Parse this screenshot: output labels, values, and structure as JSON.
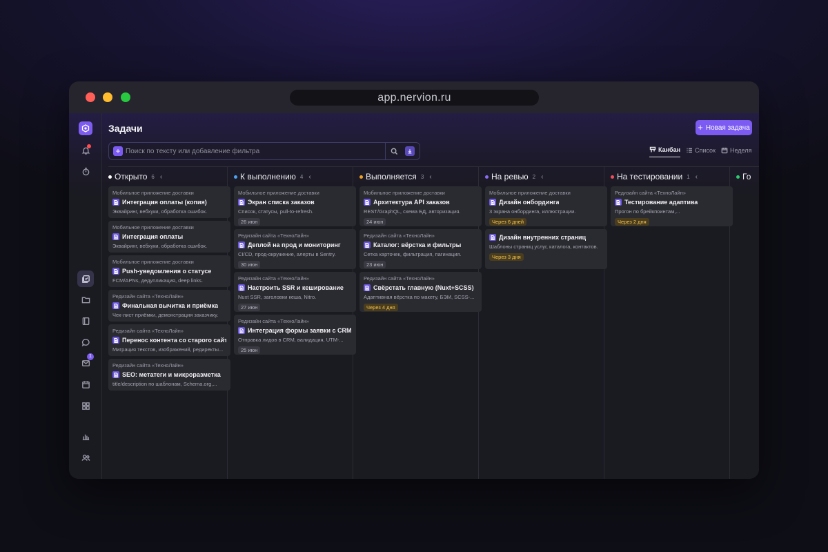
{
  "window": {
    "url": "app.nervion.ru"
  },
  "header": {
    "title": "Задачи",
    "new_task_label": "Новая задача"
  },
  "search": {
    "placeholder": "Поиск по тексту или добавление фильтра"
  },
  "views": [
    {
      "label": "Канбан",
      "active": true,
      "icon": "kanban-icon"
    },
    {
      "label": "Список",
      "active": false,
      "icon": "list-icon"
    },
    {
      "label": "Неделя",
      "active": false,
      "icon": "calendar-icon"
    }
  ],
  "sidebar": {
    "mail_badge": "1"
  },
  "columns": [
    {
      "title": "Открыто",
      "count": "6",
      "color": "#ffffff",
      "cards": [
        {
          "project": "Мобильное приложение доставки",
          "title": "Интеграция оплаты (копия)",
          "desc": "Эквайринг, вебхуки, обработка ошибок."
        },
        {
          "project": "Мобильное приложение доставки",
          "title": "Интеграция оплаты",
          "desc": "Эквайринг, вебхуки, обработка ошибок."
        },
        {
          "project": "Мобильное приложение доставки",
          "title": "Push-уведомления о статусе",
          "desc": "FCM/APNs, дедупликация, deep links."
        },
        {
          "project": "Редизайн сайта «ТехноЛайн»",
          "title": "Финальная вычитка и приёмка",
          "desc": "Чек-лист приёмки, демонстрация заказчику."
        },
        {
          "project": "Редизайн сайта «ТехноЛайн»",
          "title": "Перенос контента со старого сайта",
          "desc": "Миграция текстов, изображений, редиректы..."
        },
        {
          "project": "Редизайн сайта «ТехноЛайн»",
          "title": "SEO: метатеги и микроразметка",
          "desc": "title/description по шаблонам, Schema.org,..."
        }
      ]
    },
    {
      "title": "К выполнению",
      "count": "4",
      "color": "#4ea1f3",
      "cards": [
        {
          "project": "Мобильное приложение доставки",
          "title": "Экран списка заказов",
          "desc": "Список, статусы, pull-to-refresh.",
          "date": "26 июн"
        },
        {
          "project": "Редизайн сайта «ТехноЛайн»",
          "title": "Деплой на прод и мониторинг",
          "desc": "CI/CD, прод-окружение, алерты в Sentry.",
          "date": "30 июн"
        },
        {
          "project": "Редизайн сайта «ТехноЛайн»",
          "title": "Настроить SSR и кеширование",
          "desc": "Nuxt SSR, заголовки кеша, Nitro.",
          "date": "27 июн"
        },
        {
          "project": "Редизайн сайта «ТехноЛайн»",
          "title": "Интеграция формы заявки с CRM",
          "desc": "Отправка лидов в CRM, валидация, UTM-...",
          "date": "25 июн"
        }
      ]
    },
    {
      "title": "Выполняется",
      "count": "3",
      "color": "#f0a020",
      "cards": [
        {
          "project": "Мобильное приложение доставки",
          "title": "Архитектура API заказов",
          "desc": "REST/GraphQL, схема БД, авторизация.",
          "date": "24 июн"
        },
        {
          "project": "Редизайн сайта «ТехноЛайн»",
          "title": "Каталог: вёрстка и фильтры",
          "desc": "Сетка карточек, фильтрация, пагинация.",
          "date": "23 июн"
        },
        {
          "project": "Редизайн сайта «ТехноЛайн»",
          "title": "Свёрстать главную (Nuxt+SCSS)",
          "desc": "Адаптивная вёрстка по макету, БЭМ, SCSS-...",
          "date": "Через 4 дня",
          "warn": true
        }
      ]
    },
    {
      "title": "На ревью",
      "count": "2",
      "color": "#8b6cf5",
      "cards": [
        {
          "project": "Мобильное приложение доставки",
          "title": "Дизайн онбординга",
          "desc": "3 экрана онбординга, иллюстрации.",
          "date": "Через 6 дней",
          "warn": true
        },
        {
          "project": "",
          "title": "Дизайн внутренних страниц",
          "desc": "Шаблоны страниц услуг, каталога, контактов.",
          "date": "Через 3 дня",
          "warn": true
        }
      ]
    },
    {
      "title": "На тестировании",
      "count": "1",
      "color": "#f04e5e",
      "cards": [
        {
          "project": "Редизайн сайта «ТехноЛайн»",
          "title": "Тестирование адаптива",
          "desc": "Прогон по брейкпоинтам,...",
          "date": "Через 2 дня",
          "warn": true
        }
      ]
    },
    {
      "title": "Го",
      "count": "",
      "color": "#2ecc71",
      "cards": []
    }
  ]
}
